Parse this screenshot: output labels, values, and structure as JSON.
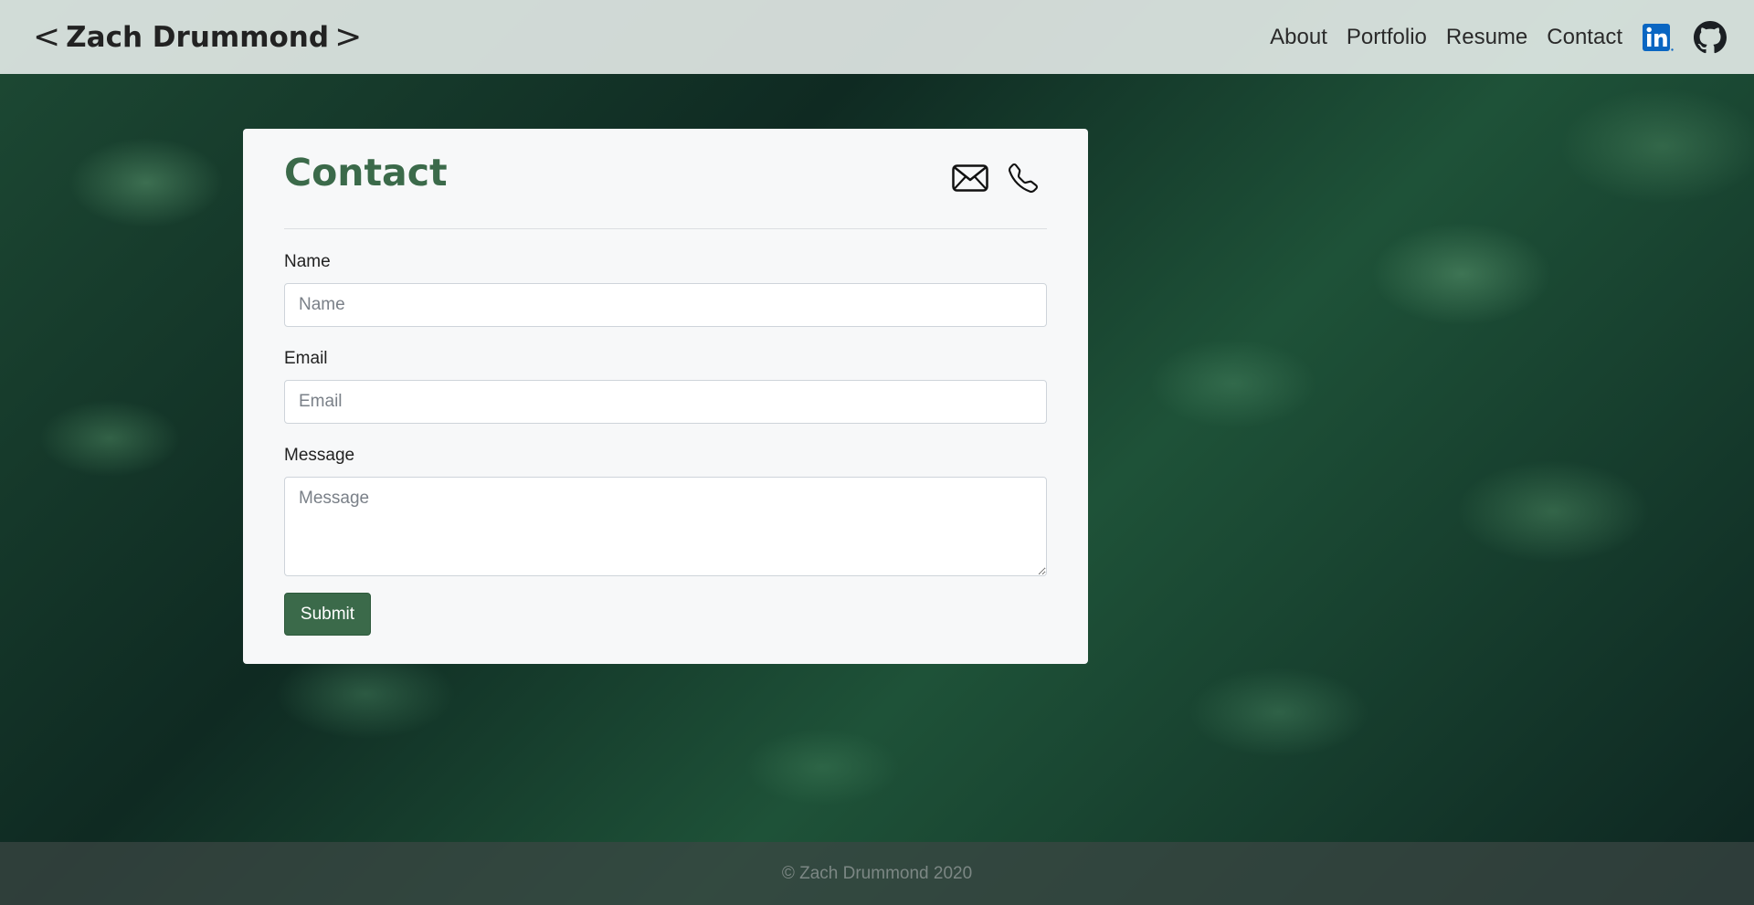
{
  "header": {
    "brand_left_chevron": "<",
    "brand_name": "Zach Drummond",
    "brand_right_chevron": ">",
    "nav": [
      {
        "label": "About"
      },
      {
        "label": "Portfolio"
      },
      {
        "label": "Resume"
      },
      {
        "label": "Contact"
      }
    ],
    "social_icons": [
      "linkedin-icon",
      "github-icon"
    ]
  },
  "card": {
    "title": "Contact",
    "header_icons": [
      "envelope-icon",
      "phone-icon"
    ],
    "form": {
      "name_label": "Name",
      "name_placeholder": "Name",
      "name_value": "",
      "email_label": "Email",
      "email_placeholder": "Email",
      "email_value": "",
      "message_label": "Message",
      "message_placeholder": "Message",
      "message_value": "",
      "submit_label": "Submit"
    }
  },
  "footer": {
    "text": "© Zach Drummond 2020"
  },
  "colors": {
    "accent": "#3b6a4a",
    "card_bg": "#f7f8f9",
    "navbar_bg": "#ebf0ee",
    "linkedin": "#0a66c2",
    "footer_text": "#7c8784"
  }
}
